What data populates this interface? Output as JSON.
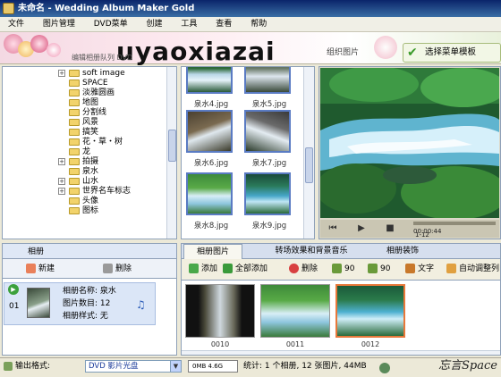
{
  "window": {
    "title": "未命名 - Wedding Album Maker Gold"
  },
  "menu": [
    "文件",
    "图片管理",
    "DVD菜单",
    "创建",
    "工具",
    "查看",
    "帮助"
  ],
  "banner": {
    "watermark": "uyaoxiazai",
    "step1_label": "编辑相册队列 DVD",
    "step2_label": "组织图片",
    "step3_label": "选择菜单模板"
  },
  "tree": {
    "items": [
      {
        "label": "soft image",
        "expand": true
      },
      {
        "label": "SPACE",
        "expand": false
      },
      {
        "label": "淡雅圆画",
        "expand": false
      },
      {
        "label": "地图",
        "expand": false
      },
      {
        "label": "分割线",
        "expand": false
      },
      {
        "label": "风景",
        "expand": false
      },
      {
        "label": "搞笑",
        "expand": false
      },
      {
        "label": "花・草・树",
        "expand": false
      },
      {
        "label": "龙",
        "expand": false
      },
      {
        "label": "拍摄",
        "expand": true
      },
      {
        "label": "泉水",
        "expand": false
      },
      {
        "label": "山水",
        "expand": true
      },
      {
        "label": "世界名车标志",
        "expand": true
      },
      {
        "label": "头像",
        "expand": false
      },
      {
        "label": "图标",
        "expand": false
      }
    ]
  },
  "thumbnails": [
    {
      "name": "泉水4.jpg"
    },
    {
      "name": "泉水5.jpg"
    },
    {
      "name": "泉水6.jpg"
    },
    {
      "name": "泉水7.jpg"
    },
    {
      "name": "泉水8.jpg"
    },
    {
      "name": "泉水9.jpg"
    }
  ],
  "player": {
    "time": "00:00:44",
    "position": "1-12"
  },
  "album_panel": {
    "tab_label": "相册",
    "new_label": "新建",
    "delete_label": "删除",
    "album": {
      "index": "01",
      "name_label": "相册名称:",
      "name_value": "泉水",
      "count_label": "图片数目:",
      "count_value": "12",
      "style_label": "相册样式:",
      "style_value": "无"
    }
  },
  "right_tabs": [
    "相册图片",
    "转场效果和背景音乐",
    "相册装饰"
  ],
  "toolbar": {
    "add": "添加",
    "add_all": "全部添加",
    "delete": "删除",
    "rotate_left": "90",
    "rotate_right": "90",
    "text": "文字",
    "auto_adjust": "自动调整列"
  },
  "filmstrip": [
    {
      "caption": "0010"
    },
    {
      "caption": "0011"
    },
    {
      "caption": "0012"
    }
  ],
  "status": {
    "format_label": "输出格式:",
    "format_value": "DVD 影片光盘",
    "capacity": "0MB    4.6G",
    "stats": "统计: 1 个相册, 12 张图片, 44MB",
    "brand": "忘言Space"
  },
  "colors": {
    "title_bg": "#0a246a",
    "selection_border": "#e8783a",
    "thumb_border": "#5a7bc3"
  }
}
